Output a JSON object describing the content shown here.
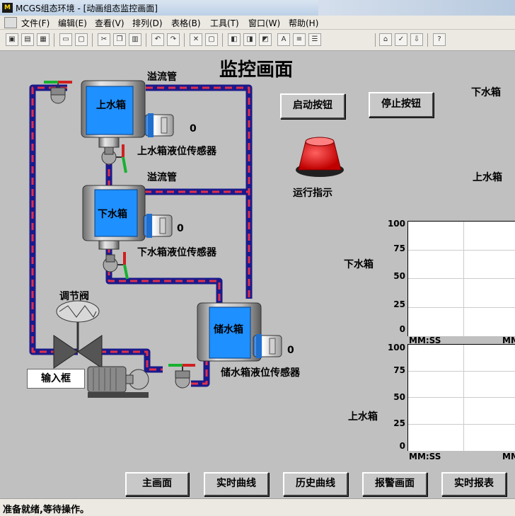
{
  "window": {
    "logo_text": "M",
    "title": "MCGS组态环境 - [动画组态监控画面]"
  },
  "menu": [
    "文件(F)",
    "编辑(E)",
    "查看(V)",
    "排列(D)",
    "表格(B)",
    "工具(T)",
    "窗口(W)",
    "帮助(H)"
  ],
  "toolbar_icons": [
    "new-window-icon",
    "open-icon",
    "save-icon",
    "print-icon",
    "print-preview-icon",
    "cut-icon",
    "copy-icon",
    "paste-icon",
    "undo-icon",
    "redo-icon",
    "tools-icon",
    "window-icon",
    "align-icon",
    "align-icon",
    "align-icon",
    "font-icon",
    "list-icon",
    "list-icon",
    "property-icon",
    "check-icon",
    "export-icon",
    "help-icon"
  ],
  "screen": {
    "title": "监控画面",
    "overflow_pipe_1": "溢流管",
    "overflow_pipe_2": "溢流管",
    "upper_tank": "上水箱",
    "lower_tank": "下水箱",
    "storage_tank": "储水箱",
    "upper_sensor": "上水箱液位传感器",
    "lower_sensor": "下水箱液位传感器",
    "storage_sensor": "储水箱液位传感器",
    "upper_sensor_value": "0",
    "lower_sensor_value": "0",
    "storage_sensor_value": "0",
    "valve_label": "调节阀",
    "input_box": "输入框",
    "start_button": "启动按钮",
    "stop_button": "停止按钮",
    "run_indicator": "运行指示",
    "right_label_lower": "下水箱",
    "right_label_upper": "上水箱"
  },
  "colors": {
    "pipe": "#1a1a8c",
    "pipe_dash": "#e0304a",
    "tank_water": "#1e90ff",
    "indicator_red": "#e00000"
  },
  "charts": [
    {
      "label": "下水箱",
      "yticks": [
        "100",
        "75",
        "50",
        "25",
        "0"
      ],
      "xticks": [
        "MM:SS",
        "MM"
      ]
    },
    {
      "label": "上水箱",
      "yticks": [
        "100",
        "75",
        "50",
        "25",
        "0"
      ],
      "xticks": [
        "MM:SS",
        "MM"
      ]
    }
  ],
  "nav_buttons": [
    "主画面",
    "实时曲线",
    "历史曲线",
    "报警画面",
    "实时报表"
  ],
  "status": "准备就绪,等待操作。"
}
